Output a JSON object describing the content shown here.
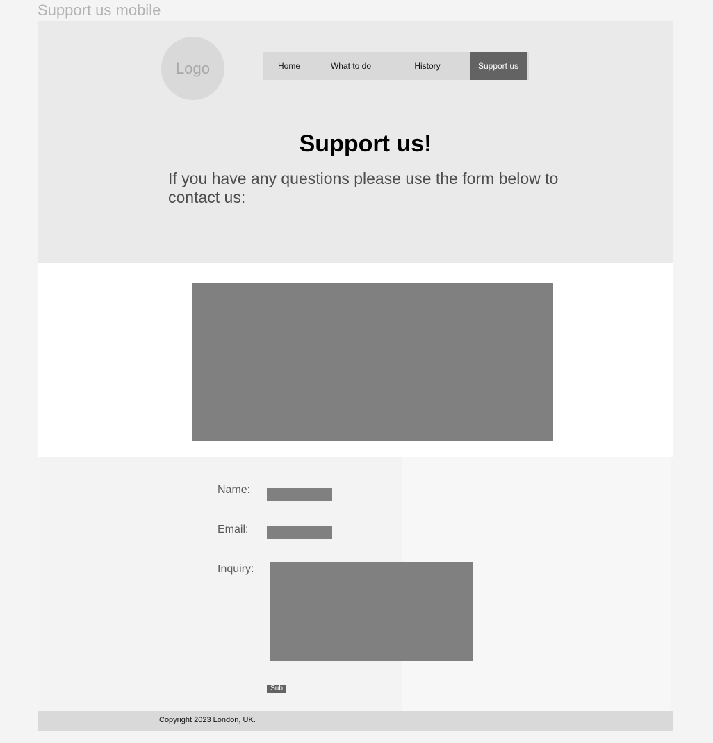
{
  "frame": {
    "title": "Support us mobile"
  },
  "header": {
    "logo": "Logo",
    "nav": [
      "Home",
      "What to do",
      "History",
      "Support us"
    ],
    "active_nav": "Support us",
    "heading": "Support us!",
    "subtitle": "If you have any questions please use the form below to contact us:"
  },
  "form": {
    "name_label": "Name:",
    "email_label": "Email:",
    "inquiry_label": "Inquiry:",
    "submit_label": "Sub"
  },
  "footer": {
    "copyright": "Copyright 2023 London, UK."
  },
  "colors": {
    "header_bg": "#eaeaea",
    "nav_bg": "#d9d9d9",
    "nav_active": "#636363",
    "placeholder": "#808080"
  }
}
